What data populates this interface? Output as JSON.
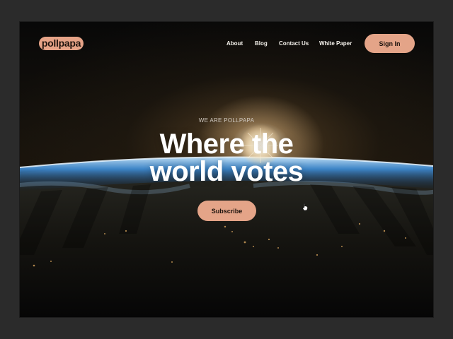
{
  "brand": {
    "logo_text": "pollpapa",
    "accent": "#e4a488"
  },
  "nav": {
    "links": [
      "About",
      "Blog",
      "Contact Us",
      "White Paper"
    ],
    "signin_label": "Sign In"
  },
  "hero": {
    "eyebrow": "WE ARE POLLPAPA",
    "headline_line1": "Where the",
    "headline_line2": "world votes",
    "cta_label": "Subscribe",
    "background": "earth-sunrise-image"
  },
  "cursor": {
    "icon": "hand-pointer-icon"
  }
}
